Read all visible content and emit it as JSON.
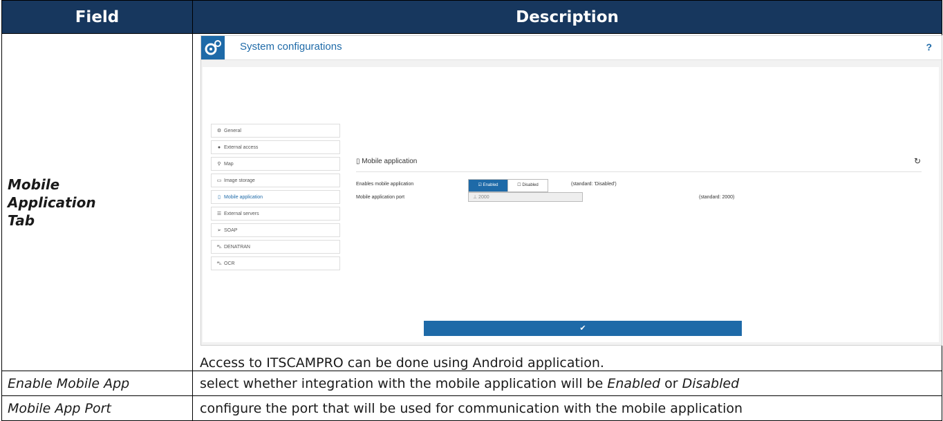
{
  "table": {
    "headers": {
      "field": "Field",
      "description": "Description"
    },
    "row1": {
      "field": "Mobile Application Tab",
      "caption": "Access to ITSCAMPRO can be done using Android application."
    },
    "row2": {
      "field": "Enable Mobile App",
      "desc_pre": "select whether integration with the mobile application will be ",
      "desc_em1": "Enabled",
      "desc_mid": " or ",
      "desc_em2": "Disabled"
    },
    "row3": {
      "field": "Mobile App Port",
      "desc": "configure the port that will be used for communication with the mobile application"
    }
  },
  "screenshot": {
    "title": "System configurations",
    "help": "?",
    "nav": [
      {
        "icon": "gear-icon",
        "glyph": "⚙",
        "label": "General"
      },
      {
        "icon": "globe-icon",
        "glyph": "●",
        "label": "External access"
      },
      {
        "icon": "map-pin-icon",
        "glyph": "⚲",
        "label": "Map"
      },
      {
        "icon": "hdd-icon",
        "glyph": "▭",
        "label": "Image storage"
      },
      {
        "icon": "mobile-icon",
        "glyph": "▯",
        "label": "Mobile application"
      },
      {
        "icon": "list-icon",
        "glyph": "☰",
        "label": "External servers"
      },
      {
        "icon": "send-icon",
        "glyph": "➢",
        "label": "SOAP"
      },
      {
        "icon": "car-icon",
        "glyph": "⛍",
        "label": "DENATRAN"
      },
      {
        "icon": "car-icon",
        "glyph": "⛍",
        "label": "OCR"
      }
    ],
    "section_title": "Mobile application",
    "reset_glyph": "↻",
    "enable_label": "Enables mobile application",
    "toggle_on": "Enabled",
    "toggle_off": "Disabled",
    "enable_standard": "(standard: 'Disabled')",
    "port_label": "Mobile application port",
    "port_value": "2000",
    "port_standard": "(standard: 2000)",
    "save_glyph": "✔",
    "accent": "#1e6aa8"
  }
}
